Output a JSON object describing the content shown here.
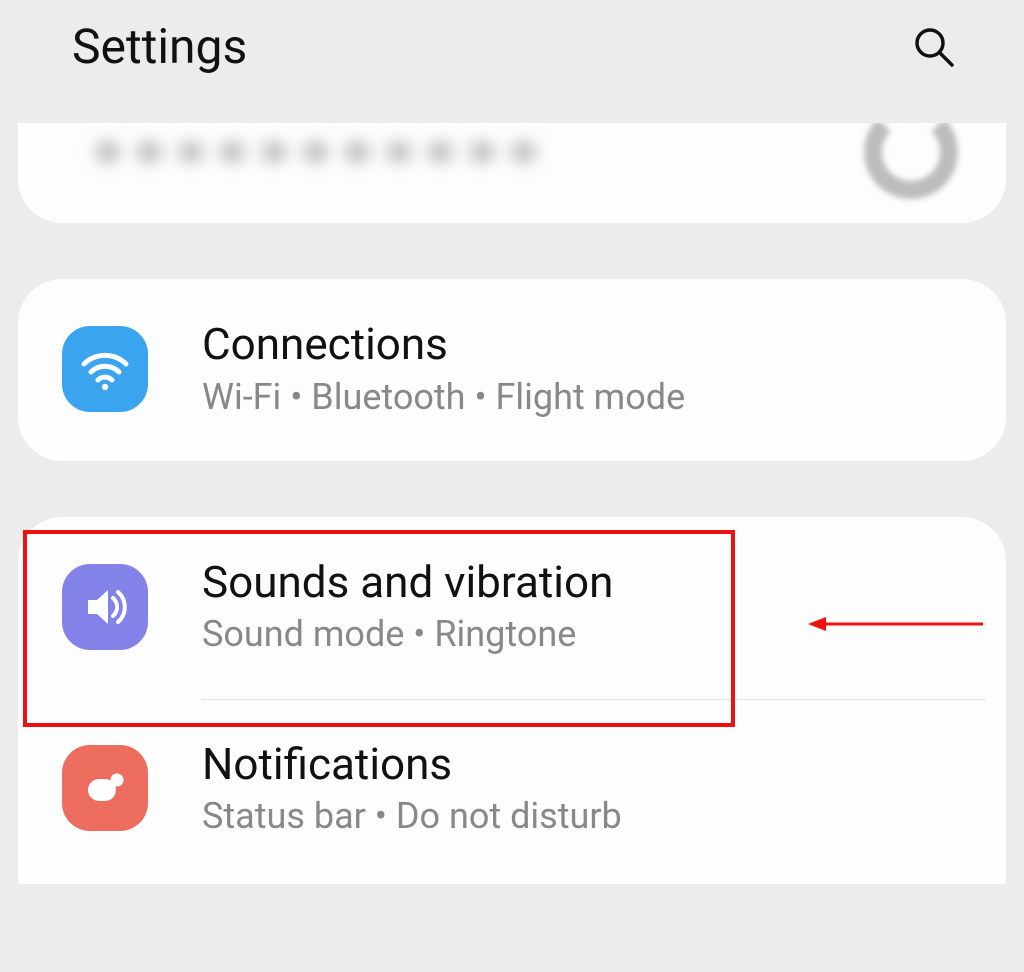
{
  "header": {
    "title": "Settings"
  },
  "items": {
    "connections": {
      "title": "Connections",
      "sub": "Wi-Fi  •  Bluetooth  •  Flight mode"
    },
    "sounds": {
      "title": "Sounds and vibration",
      "sub": "Sound mode  •  Ringtone"
    },
    "notifications": {
      "title": "Notifications",
      "sub": "Status bar  •  Do not disturb"
    }
  },
  "annotation": {
    "highlight_target": "sounds-and-vibration"
  }
}
